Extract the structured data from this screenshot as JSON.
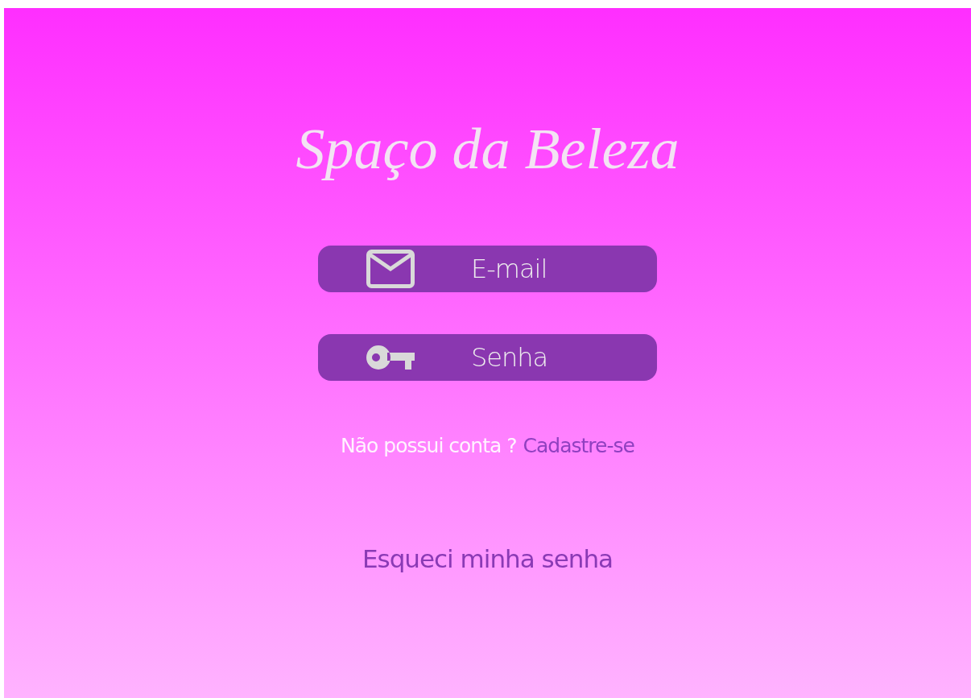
{
  "title": "Spaço da Beleza",
  "fields": [
    {
      "kind": "email",
      "placeholder": "E-mail"
    },
    {
      "kind": "password",
      "placeholder": "Senha"
    }
  ],
  "signup": {
    "prompt": "Não possui conta ?",
    "link": "Cadastre-se"
  },
  "forgot_link": "Esqueci minha senha"
}
